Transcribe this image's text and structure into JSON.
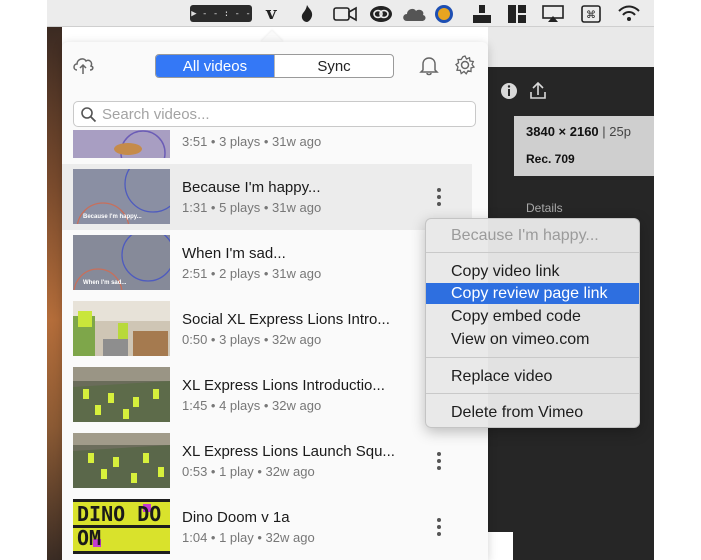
{
  "menubar": {
    "timer": "▶ - - : - -",
    "icons": [
      "timer-widget",
      "vimeo-icon",
      "flame-icon",
      "camera-icon",
      "creative-cloud-icon",
      "cloud-icon",
      "record-icon",
      "usb-icon",
      "grid-icon",
      "airplay-icon",
      "keyboard-icon",
      "wifi-icon"
    ]
  },
  "popover": {
    "tabs": [
      "All videos",
      "Sync"
    ],
    "active_tab": "All videos",
    "search": {
      "placeholder": "Search videos..."
    },
    "videos": [
      {
        "title": "",
        "meta": "3:51 • 3 plays • 31w ago",
        "thumb": "purple-circles"
      },
      {
        "title": "Because I'm happy...",
        "meta": "1:31 • 5 plays • 31w ago",
        "thumb_text": "Because I'm happy...",
        "highlighted": true
      },
      {
        "title": "When I'm sad...",
        "meta": "2:51 • 2 plays • 31w ago",
        "thumb_text": "When I'm sad..."
      },
      {
        "title": "Social XL Express Lions Intro...",
        "meta": "0:50 • 3 plays • 32w ago"
      },
      {
        "title": "XL Express Lions Introductio...",
        "meta": "1:45 • 4 plays • 32w ago"
      },
      {
        "title": "XL Express Lions Launch Squ...",
        "meta": "0:53 • 1 play • 32w ago"
      },
      {
        "title": "Dino Doom v 1a",
        "meta": "1:04 • 1 play • 32w ago",
        "thumb_text": "DINO DOOM"
      }
    ]
  },
  "context_menu": {
    "header": "Because I'm happy...",
    "items": [
      "Copy video link",
      "Copy review page link",
      "Copy embed code",
      "View on vimeo.com"
    ],
    "selected": "Copy review page link",
    "replace": "Replace video",
    "delete": "Delete from Vimeo"
  },
  "background_app": {
    "resolution": "3840 × 2160",
    "fps": "| 25p",
    "rec": "Rec. 709",
    "details": "Details"
  },
  "colors": {
    "accent": "#3478f6",
    "selection": "#2e6fe0",
    "dark_panel": "#262626"
  }
}
